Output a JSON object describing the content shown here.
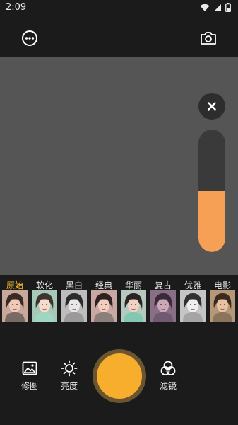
{
  "status_bar": {
    "time": "2:09"
  },
  "toolbar": {
    "more_icon": "more-dots-icon",
    "camera_icon": "camera-switch-icon"
  },
  "adjust": {
    "close_icon": "close-icon",
    "level": 0.5
  },
  "colors": {
    "accent": "#f5b82e",
    "slider_fill": "#f6a055",
    "shutter": "#f7ae2c",
    "background": "#1b1b1b",
    "preview": "#555555"
  },
  "filters": [
    {
      "label": "原始",
      "selected": true
    },
    {
      "label": "软化",
      "selected": false
    },
    {
      "label": "黑白",
      "selected": false
    },
    {
      "label": "经典",
      "selected": false
    },
    {
      "label": "华丽",
      "selected": false
    },
    {
      "label": "复古",
      "selected": false
    },
    {
      "label": "优雅",
      "selected": false
    },
    {
      "label": "电影",
      "selected": false
    }
  ],
  "bottom": {
    "edit_label": "修图",
    "brightness_label": "亮度",
    "filter_label": "滤镜"
  }
}
